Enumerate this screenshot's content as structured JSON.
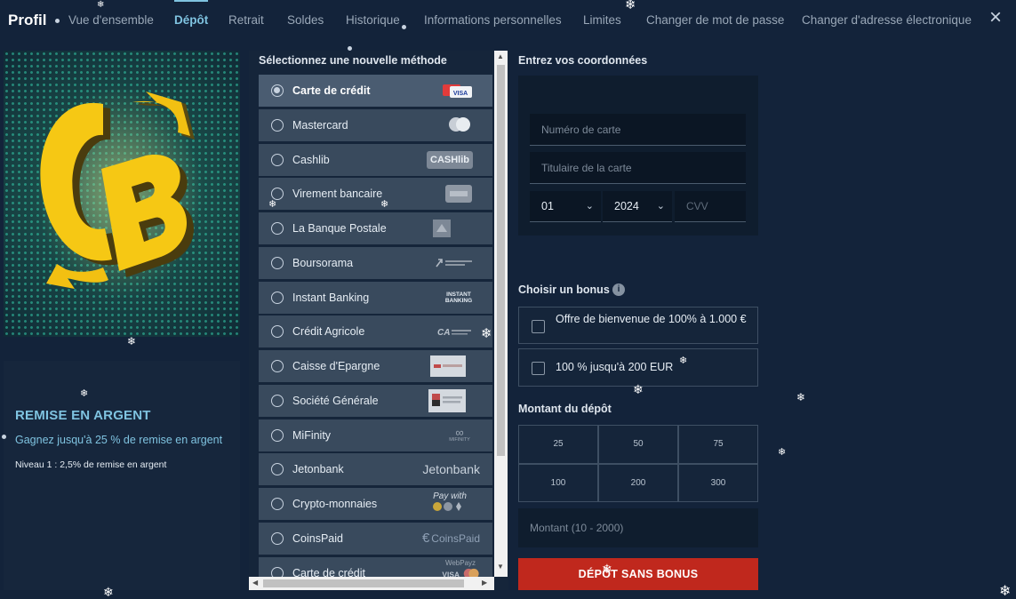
{
  "header": {
    "title": "Profil",
    "tabs": [
      {
        "label": "Vue d'ensemble"
      },
      {
        "label": "Dépôt"
      },
      {
        "label": "Retrait"
      },
      {
        "label": "Soldes"
      },
      {
        "label": "Historique"
      },
      {
        "label": "Informations personnelles"
      },
      {
        "label": "Limites"
      },
      {
        "label": "Changer de mot de passe"
      },
      {
        "label": "Changer d'adresse électronique"
      }
    ],
    "active_tab": "Dépôt",
    "close_icon": "×"
  },
  "promo": {
    "title": "REMISE EN ARGENT",
    "subtitle": "Gagnez jusqu'à 25 % de remise en argent",
    "level": "Niveau 1 : 2,5% de remise en argent"
  },
  "methods": {
    "title": "Sélectionnez une nouvelle méthode",
    "items": [
      {
        "label": "Carte de crédit",
        "selected": true
      },
      {
        "label": "Mastercard"
      },
      {
        "label": "Cashlib",
        "logo": "CASHlib"
      },
      {
        "label": "Virement bancaire"
      },
      {
        "label": "La Banque Postale"
      },
      {
        "label": "Boursorama"
      },
      {
        "label": "Instant Banking",
        "logo": "INSTANT BANKING"
      },
      {
        "label": "Crédit Agricole"
      },
      {
        "label": "Caisse d'Epargne"
      },
      {
        "label": "Société Générale"
      },
      {
        "label": "MiFinity",
        "logo": "MIFINITY"
      },
      {
        "label": "Jetonbank",
        "logo": "Jetonbank"
      },
      {
        "label": "Crypto-monnaies",
        "logo": "Pay with"
      },
      {
        "label": "CoinsPaid",
        "logo": "CoinsPaid"
      },
      {
        "label": "Carte de crédit",
        "logo": "WebPayz"
      }
    ]
  },
  "form": {
    "title": "Entrez vos coordonnées",
    "card_number_placeholder": "Numéro de carte",
    "card_holder_placeholder": "Titulaire de la carte",
    "month": "01",
    "year": "2024",
    "cvv_placeholder": "CVV"
  },
  "bonus": {
    "title": "Choisir un bonus",
    "info_icon": "i",
    "options": [
      {
        "label": "Offre de bienvenue de 100% à 1.000 €"
      },
      {
        "label": "100 % jusqu'à 200 EUR"
      }
    ]
  },
  "amount": {
    "title": "Montant du dépôt",
    "presets": [
      "25",
      "50",
      "75",
      "100",
      "200",
      "300"
    ],
    "placeholder": "Montant (10 - 2000)"
  },
  "deposit_button": "DÉPÔT SANS BONUS"
}
